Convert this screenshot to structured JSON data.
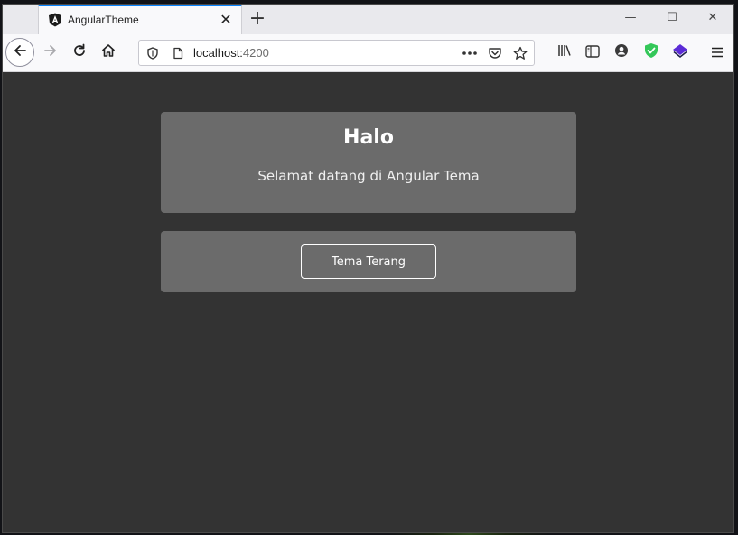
{
  "browser": {
    "tab": {
      "title": "AngularTheme",
      "close": "✕"
    },
    "new_tab": "+",
    "window_controls": {
      "minimize": "—",
      "maximize": "☐",
      "close": "✕"
    },
    "address": {
      "host": "localhost:",
      "port": "4200"
    },
    "icons": {
      "back": "back-arrow-icon",
      "forward": "forward-arrow-icon",
      "reload": "reload-icon",
      "home": "home-icon",
      "tracking": "shield-icon",
      "page": "page-icon",
      "actions": "more-actions-icon",
      "pocket": "pocket-icon",
      "bookmark": "star-icon",
      "library": "library-icon",
      "sidebar": "sidebar-icon",
      "account": "account-icon",
      "ext1": "green-shield-extension-icon",
      "ext2": "purple-layers-extension-icon",
      "menu": "hamburger-menu-icon"
    },
    "colors": {
      "tab_accent": "#0a84ff",
      "ext_green": "#34c759",
      "ext_purple": "#5b2bd6"
    }
  },
  "page": {
    "greeting": {
      "title": "Halo",
      "subtitle": "Selamat datang di Angular Tema"
    },
    "toggle": {
      "label": "Tema Terang"
    },
    "colors": {
      "background": "#333333",
      "card": "#6b6b6b",
      "text": "#ffffff"
    }
  }
}
